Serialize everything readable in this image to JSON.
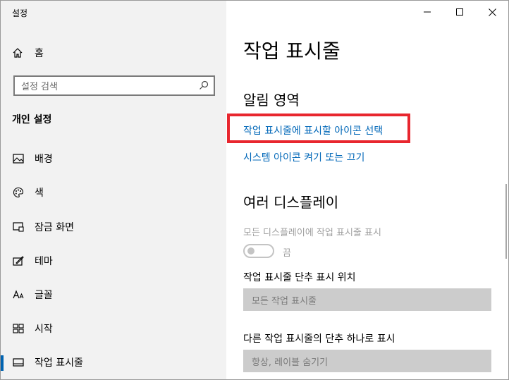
{
  "window": {
    "title": "설정",
    "controls": {
      "minimize": "—",
      "maximize": "☐",
      "close": "✕"
    }
  },
  "sidebar": {
    "home_label": "홈",
    "search_placeholder": "설정 검색",
    "section_heading": "개인 설정",
    "items": [
      {
        "label": "배경",
        "icon": "picture-icon"
      },
      {
        "label": "색",
        "icon": "palette-icon"
      },
      {
        "label": "잠금 화면",
        "icon": "lock-screen-icon"
      },
      {
        "label": "테마",
        "icon": "theme-icon"
      },
      {
        "label": "글꼴",
        "icon": "fonts-icon"
      },
      {
        "label": "시작",
        "icon": "start-icon"
      },
      {
        "label": "작업 표시줄",
        "icon": "taskbar-icon",
        "active": true
      }
    ]
  },
  "main": {
    "title": "작업 표시줄",
    "notification_area": {
      "heading": "알림 영역",
      "links": [
        "작업 표시줄에 표시할 아이콘 선택",
        "시스템 아이콘 켜기 또는 끄기"
      ]
    },
    "multiple_displays": {
      "heading": "여러 디스플레이",
      "show_on_all_label": "모든 디스플레이에 작업 표시줄 표시",
      "toggle_state": "끔",
      "buttons_location_label": "작업 표시줄 단추 표시 위치",
      "buttons_location_value": "모든 작업 표시줄",
      "combine_label": "다른 작업 표시줄의 단추 하나로 표시",
      "combine_value": "항상, 레이블 숨기기"
    }
  },
  "colors": {
    "accent": "#0063b1",
    "link": "#0067b8",
    "highlight_box": "#e8262e",
    "sidebar_bg": "#f2f2f2"
  }
}
